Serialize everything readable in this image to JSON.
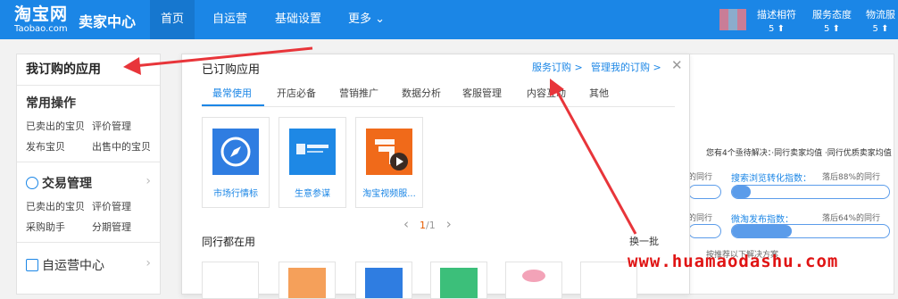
{
  "topbar": {
    "logo_cn": "淘宝网",
    "logo_en": "Taobao.com",
    "seller_center": "卖家中心",
    "nav": [
      "首页",
      "自运营",
      "基础设置",
      "更多 ⌄"
    ],
    "metrics": [
      {
        "label": "描述相符",
        "value": "5 ⬆"
      },
      {
        "label": "服务态度",
        "value": "5 ⬆"
      },
      {
        "label": "物流服",
        "value": "5 ⬆"
      }
    ]
  },
  "sidebar": {
    "title": "我订购的应用",
    "common_ops_title": "常用操作",
    "common_ops": [
      "已卖出的宝贝",
      "评价管理",
      "发布宝贝",
      "出售中的宝贝"
    ],
    "trade_title": "交易管理",
    "trade_links": [
      "已卖出的宝贝",
      "评价管理",
      "采购助手",
      "分期管理"
    ],
    "selfop_title": "自运营中心"
  },
  "panel": {
    "title": "已订购应用",
    "service_link": "服务订购 >",
    "manage_link": "管理我的订购 >",
    "close": "✕",
    "tabs": [
      "最常使用",
      "开店必备",
      "营销推广",
      "数据分析",
      "客服管理",
      "内容互动",
      "其他"
    ],
    "apps": [
      {
        "label": "市场行情标",
        "icon": "compass-icon",
        "color": "#2f7de1"
      },
      {
        "label": "生意参谋",
        "icon": "business-advisor-icon",
        "color": "#1e88e5"
      },
      {
        "label": "淘宝视频服...",
        "icon": "taobao-video-icon",
        "color": "#f06a1a"
      }
    ],
    "pager_prev": "‹",
    "pager_current": "1",
    "pager_total": "/1",
    "pager_next": "›",
    "peers_title": "同行都在用",
    "refresh": "换一批"
  },
  "right_area": {
    "summary": "您有4个亟待解决：·同行卖家均值  ·同行优质卖家均值",
    "peer_label": "的同行",
    "metric1_label": "搜索浏览转化指数：",
    "metric1_note": "落后88%的同行",
    "metric2_label": "微淘发布指数：",
    "metric2_note": "落后64%的同行",
    "bottom_text": "按推荐以下解决方案",
    "metric1_fill": 0.12,
    "metric2_fill": 0.38
  },
  "watermark": "www.huamaodashu.com"
}
